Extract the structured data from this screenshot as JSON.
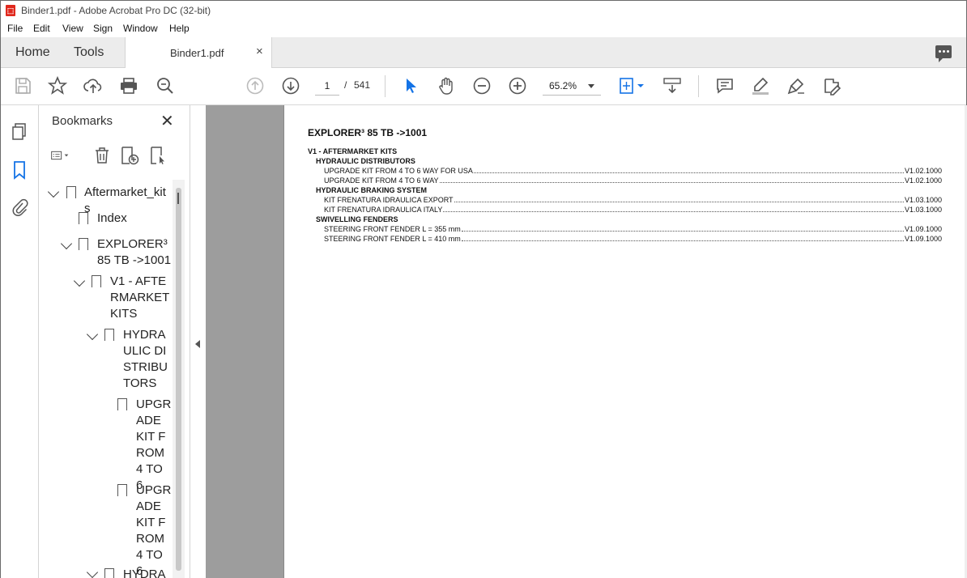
{
  "window": {
    "title": "Binder1.pdf - Adobe Acrobat Pro DC (32-bit)"
  },
  "menu": [
    "File",
    "Edit",
    "View",
    "Sign",
    "Window",
    "Help"
  ],
  "tabs": {
    "home": "Home",
    "tools": "Tools",
    "document": "Binder1.pdf",
    "close": "×"
  },
  "toolbar": {
    "page_current": "1",
    "page_separator": "/",
    "page_total": "541",
    "zoom": "65.2%"
  },
  "bookmarks_panel": {
    "title": "Bookmarks",
    "close": "✕",
    "items": [
      {
        "label": "Aftermarket_kits"
      },
      {
        "label": "Index"
      },
      {
        "label": "EXPLORER³ 85 TB ->1001"
      },
      {
        "label": "V1 - AFTERMARKET KITS"
      },
      {
        "label": "HYDRAULIC DISTRIBUTORS"
      },
      {
        "label": "UPGRADE KIT FROM 4 TO 6"
      },
      {
        "label": "UPGRADE KIT FROM 4 TO 6"
      },
      {
        "label": "HYDRAU"
      }
    ]
  },
  "document": {
    "title": "EXPLORER³ 85 TB ->1001",
    "section": "V1 - AFTERMARKET KITS",
    "groups": [
      {
        "heading": "HYDRAULIC DISTRIBUTORS",
        "entries": [
          {
            "text": "UPGRADE KIT FROM 4 TO 6 WAY FOR USA",
            "page": "V1.02.1000"
          },
          {
            "text": "UPGRADE KIT FROM 4 TO 6 WAY",
            "page": "V1.02.1000"
          }
        ]
      },
      {
        "heading": "HYDRAULIC BRAKING SYSTEM",
        "entries": [
          {
            "text": "KIT FRENATURA IDRAULICA EXPORT",
            "page": "V1.03.1000"
          },
          {
            "text": "KIT FRENATURA IDRAULICA ITALY",
            "page": "V1.03.1000"
          }
        ]
      },
      {
        "heading": "SWIVELLING FENDERS",
        "entries": [
          {
            "text": "STEERING FRONT FENDER L = 355 mm",
            "page": "V1.09.1000"
          },
          {
            "text": "STEERING FRONT FENDER L = 410 mm",
            "page": "V1.09.1000"
          }
        ]
      }
    ]
  }
}
